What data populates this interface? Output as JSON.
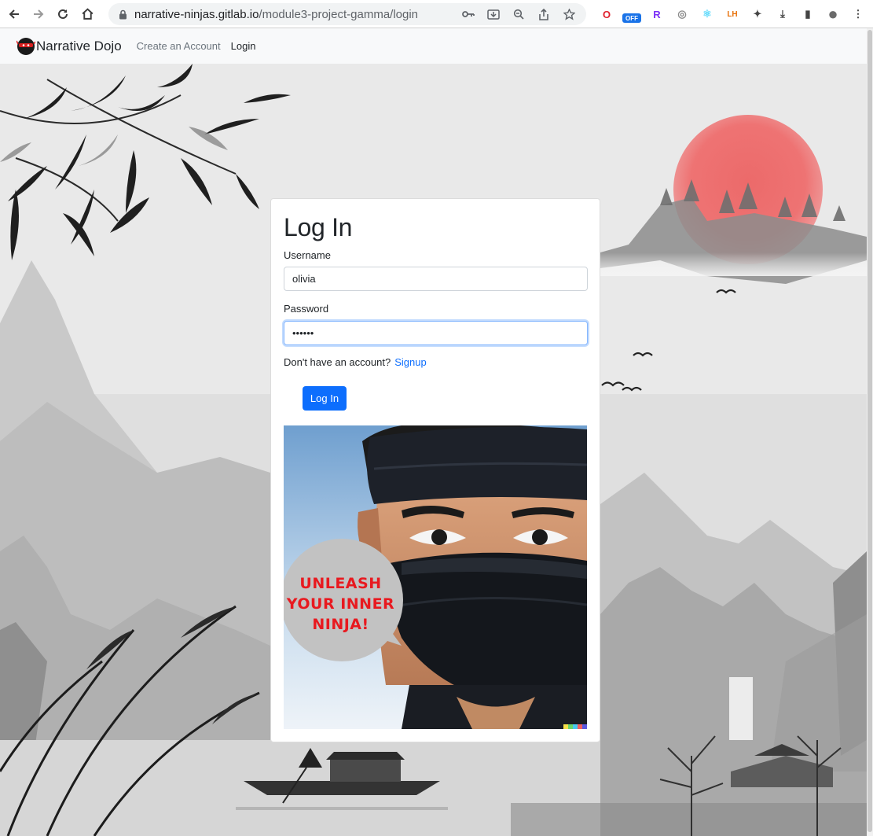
{
  "browser": {
    "url_host": "narrative-ninjas.gitlab.io",
    "url_path": "/module3-project-gamma/login",
    "extensions": [
      {
        "name": "opera-icon",
        "glyph": "O",
        "color": "#e0202c"
      },
      {
        "name": "off-badge-icon",
        "glyph": "OFF",
        "color": "#1a73e8"
      },
      {
        "name": "r-extension-icon",
        "glyph": "R",
        "color": "#7b2ff7"
      },
      {
        "name": "eye-extension-icon",
        "glyph": "◎",
        "color": "#8a8a8a"
      },
      {
        "name": "react-devtools-icon",
        "glyph": "⚛",
        "color": "#61dafb"
      },
      {
        "name": "lighthouse-icon",
        "glyph": "LH",
        "color": "#e8710a"
      },
      {
        "name": "puzzle-icon",
        "glyph": "✦",
        "color": "#444444"
      },
      {
        "name": "download-icon",
        "glyph": "⤓",
        "color": "#444444"
      },
      {
        "name": "side-panel-icon",
        "glyph": "▮",
        "color": "#444444"
      },
      {
        "name": "profile-avatar",
        "glyph": "●",
        "color": "#6b6b6b"
      },
      {
        "name": "kebab-menu-icon",
        "glyph": "⋮",
        "color": "#444444"
      }
    ]
  },
  "navbar": {
    "brand": "Narrative Dojo",
    "links": [
      {
        "label": "Create an Account"
      },
      {
        "label": "Login"
      }
    ]
  },
  "login": {
    "title": "Log In",
    "username_label": "Username",
    "username_value": "olivia",
    "password_label": "Password",
    "password_value": "••••••",
    "no_account_text": "Don't have an account?",
    "signup_link": "Signup",
    "submit_label": "Log In",
    "poster_caption_1": "UNLEASH",
    "poster_caption_2": "YOUR INNER",
    "poster_caption_3": "NINJA!"
  },
  "colors": {
    "primary": "#0d6efd",
    "sun": "#e86b6b",
    "caption": "#e8191f"
  }
}
